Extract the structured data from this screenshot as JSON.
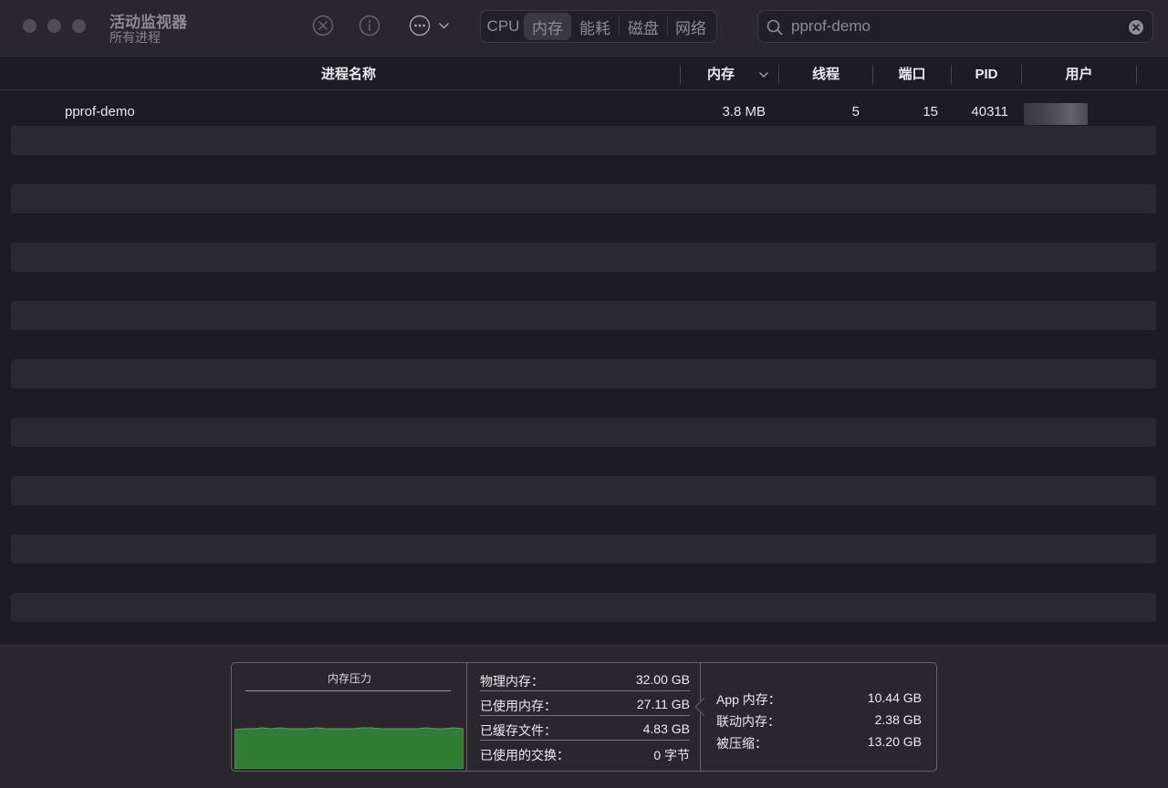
{
  "window": {
    "title": "活动监视器",
    "subtitle": "所有进程"
  },
  "toolbar": {
    "stop_icon": "x-circle-icon",
    "info_icon": "info-circle-icon",
    "more_icon": "ellipsis-circle-icon"
  },
  "tabs": [
    {
      "label": "CPU",
      "active": false
    },
    {
      "label": "内存",
      "active": true
    },
    {
      "label": "能耗",
      "active": false
    },
    {
      "label": "磁盘",
      "active": false
    },
    {
      "label": "网络",
      "active": false
    }
  ],
  "search": {
    "value": "pprof-demo"
  },
  "table": {
    "columns": {
      "name": "进程名称",
      "memory": "内存",
      "threads": "线程",
      "ports": "端口",
      "pid": "PID",
      "user": "用户"
    },
    "sort_column": "memory",
    "sort_direction": "descending",
    "rows": [
      {
        "name": "pprof-demo",
        "memory": "3.8 MB",
        "threads": "5",
        "ports": "15",
        "pid": "40311"
      }
    ]
  },
  "summary": {
    "pressure_title": "内存压力",
    "pressure_color": "#2e7d32",
    "stats": [
      {
        "label": "物理内存：",
        "value": "32.00 GB"
      },
      {
        "label": "已使用内存：",
        "value": "27.11 GB"
      },
      {
        "label": "已缓存文件：",
        "value": "4.83 GB"
      },
      {
        "label": "已使用的交换：",
        "value": "0 字节"
      }
    ],
    "breakdown": [
      {
        "label": "App 内存：",
        "value": "10.44 GB"
      },
      {
        "label": "联动内存：",
        "value": "2.38 GB"
      },
      {
        "label": "被压缩：",
        "value": "13.20 GB"
      }
    ]
  }
}
